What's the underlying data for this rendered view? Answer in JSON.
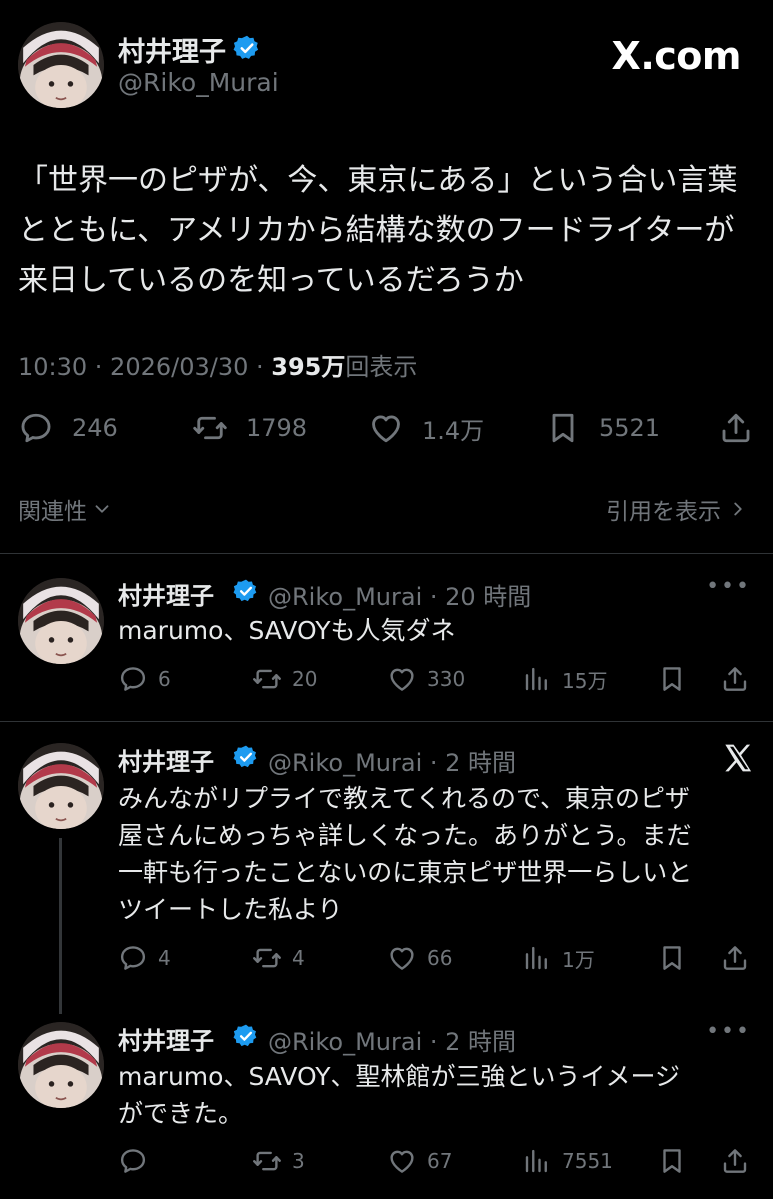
{
  "main_tweet": {
    "author_name": "村井理子",
    "handle": "@Riko_Murai",
    "source_badge": "X.com",
    "body_lines": [
      "「世界一のピザが、今、東京にある」という合い言葉",
      "とともに、アメリカから結構な数のフードライターが",
      "来日しているのを知っているだろうか"
    ],
    "time_date": "10:30 · 2026/03/30 · ",
    "views_count": "395万",
    "views_label": "回表示",
    "replies": "246",
    "reposts": "1798",
    "likes": "1.4万",
    "bookmarks": "5521"
  },
  "sort_label": "関連性",
  "quotes_label": "引用を表示",
  "replies": [
    {
      "author_name": "村井理子",
      "handle_time": "@Riko_Murai · 20 時間",
      "body_lines": [
        "marumo、SAVOYも人気ダネ"
      ],
      "replies": "6",
      "reposts": "20",
      "likes": "330",
      "views": "15万"
    },
    {
      "author_name": "村井理子",
      "handle_time": "@Riko_Murai · 2 時間",
      "body_lines": [
        "みんながリプライで教えてくれるので、東京のピザ",
        "屋さんにめっちゃ詳しくなった。ありがとう。まだ",
        "一軒も行ったことないのに東京ピザ世界一らしいと",
        "ツイートした私より"
      ],
      "replies": "4",
      "reposts": "4",
      "likes": "66",
      "views": "1万"
    },
    {
      "author_name": "村井理子",
      "handle_time": "@Riko_Murai · 2 時間",
      "body_lines": [
        "marumo、SAVOY、聖林館が三強というイメージ",
        "ができた。"
      ],
      "replies": "",
      "reposts": "3",
      "likes": "67",
      "views": "7551"
    }
  ],
  "icons": {
    "reply": "reply-icon",
    "repost": "repost-icon",
    "like": "heart-icon",
    "bookmark": "bookmark-icon",
    "share": "share-icon",
    "views": "views-icon",
    "verified": "verified-badge-icon",
    "more": "more-icon",
    "x_logo": "x-logo-icon"
  },
  "colors": {
    "background": "#000000",
    "text": "#e7e9ea",
    "muted": "#71767b",
    "verified": "#1d9bf0",
    "divider": "#2f3336"
  }
}
